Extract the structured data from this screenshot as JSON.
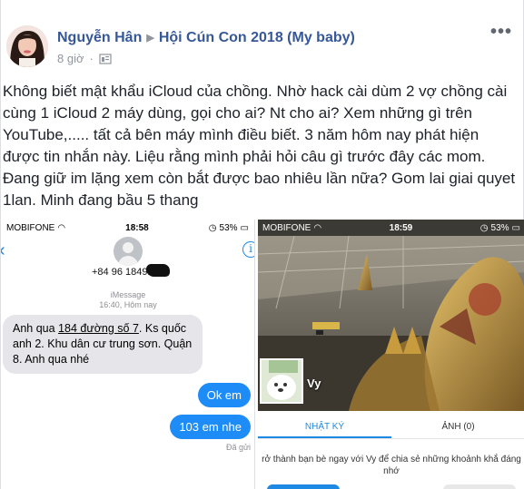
{
  "post": {
    "author": "Nguyễn Hân",
    "group": "Hội Cún Con 2018 (My baby)",
    "time": "8 giờ",
    "more": "•••",
    "text": "Không biết mật khẩu iCloud của chồng. Nhờ hack cài dùm 2 vợ chồng cài cùng 1 iCloud 2 máy dùng, gọi cho ai? Nt cho ai? Xem những gì trên YouTube,..... tất cả bên máy mình điều biết. 3 năm hôm nay phát hiện được tin nhắn này. Liệu rằng mình phải hỏi câu gì trước đây các mom. Đang giữ im lặng xem còn bắt được bao nhiêu lần nữa? Gom lai giai quyet 1lan. Minh đang bầu 5 thang"
  },
  "photo_left": {
    "carrier": "MOBIFONE",
    "clock": "18:58",
    "battery": "53%",
    "contact_number": "+84 96 18491",
    "service": "iMessage",
    "timestamp": "16:40, Hôm nay",
    "incoming_pre": "Anh qua ",
    "incoming_u1": "184 đường số 7",
    "incoming_mid": ". Ks quốc anh 2. Khu dân cư trung sơn. Quận 8. Anh qua nhé",
    "outgoing1": "Ok em",
    "outgoing2": "103 em nhe",
    "delivered": "Đã gửi"
  },
  "photo_right": {
    "carrier": "MOBIFONE",
    "clock": "18:59",
    "battery": "53%",
    "profile_name": "Vy",
    "tab_diary": "NHẬT KÝ",
    "tab_photos": "ẢNH (0)",
    "friend_prompt": "rở thành bạn bè ngay với Vy để chia sẻ những khoảnh khắ đáng nhớ"
  },
  "colors": {
    "link": "#365899",
    "imessage_blue": "#1e8cf7",
    "zalo_blue": "#1e88e5"
  }
}
